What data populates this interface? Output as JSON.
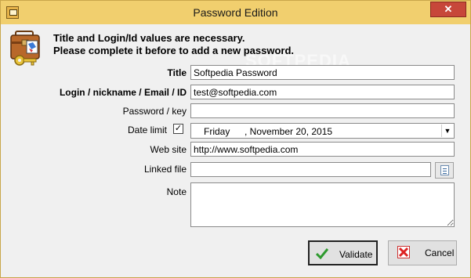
{
  "window": {
    "title": "Password Edition",
    "close_glyph": "✕"
  },
  "header": {
    "line1": "Title and Login/Id values are necessary.",
    "line2": "Please complete it before to add a new password.",
    "icon": "briefcase-key-icon"
  },
  "watermark": "SOFTPEDIA",
  "form": {
    "title_label": "Title",
    "title_value": "Softpedia Password",
    "login_label": "Login / nickname / Email / ID",
    "login_value": "test@softpedia.com",
    "password_label": "Password / key",
    "password_value": "",
    "date_limit_label": "Date limit",
    "date_limit_checked": "✓",
    "date_day": "Friday",
    "date_rest": ", November 20, 2015",
    "website_label": "Web site",
    "website_value": "http://www.softpedia.com",
    "linked_file_label": "Linked file",
    "linked_file_value": "",
    "note_label": "Note",
    "note_value": ""
  },
  "buttons": {
    "validate": "Validate",
    "cancel": "Cancel"
  }
}
